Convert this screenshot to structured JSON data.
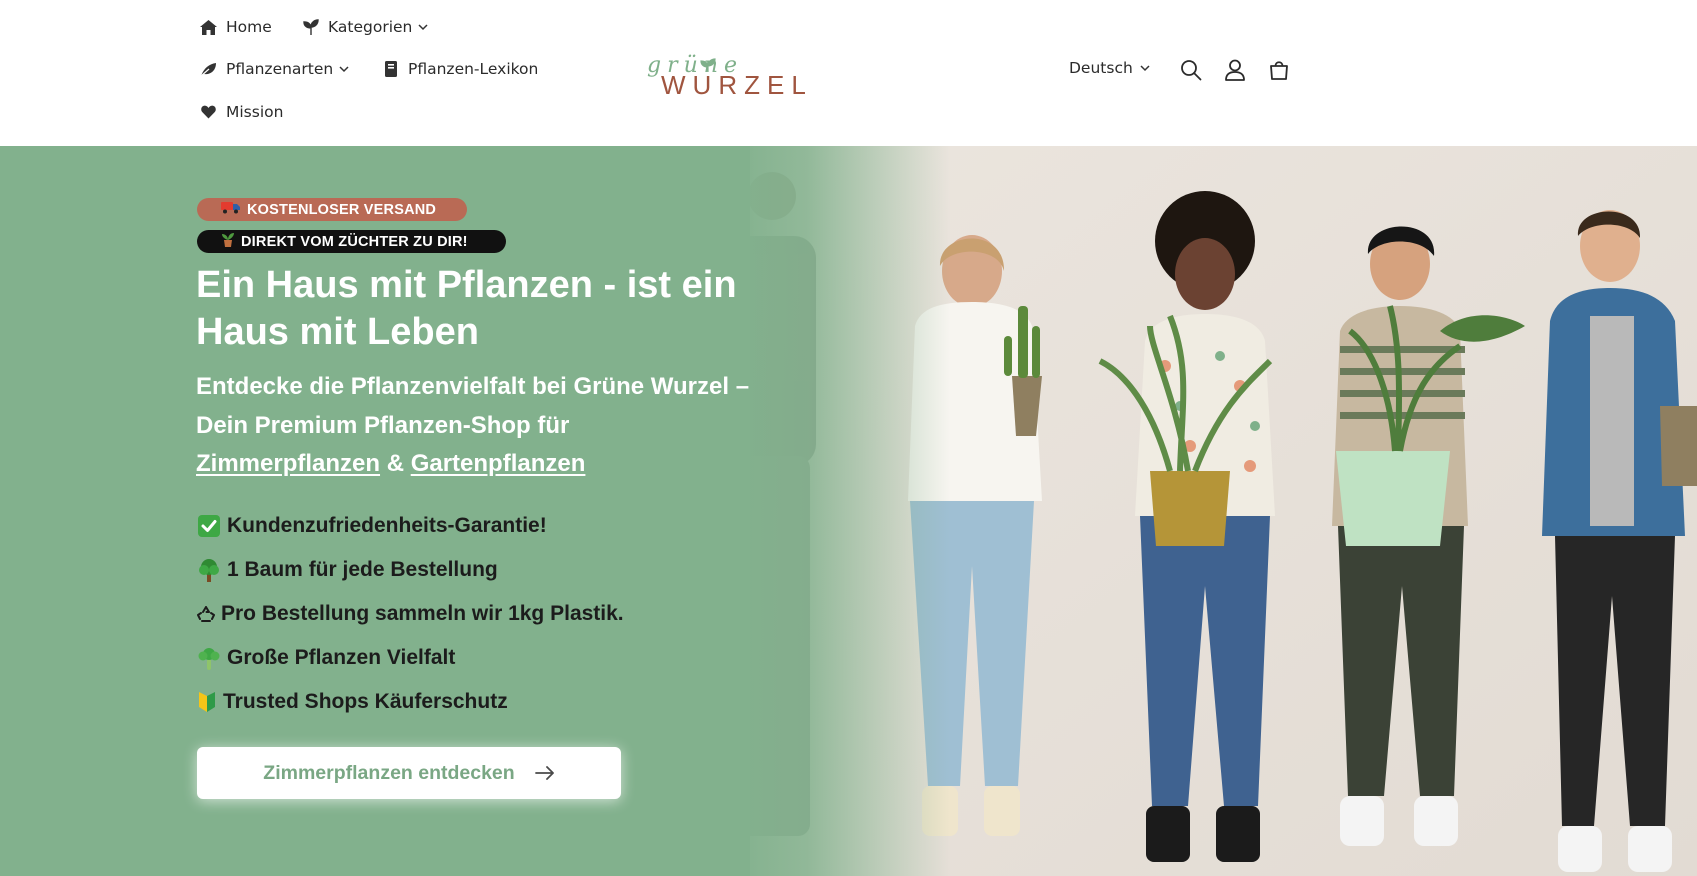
{
  "nav": {
    "home": "Home",
    "kategorien": "Kategorien",
    "pflanzenarten": "Pflanzenarten",
    "lexikon": "Pflanzen-Lexikon",
    "mission": "Mission"
  },
  "logo": {
    "top": "grüne",
    "bottom": "WURZEL"
  },
  "language": {
    "selected": "Deutsch"
  },
  "icons": {
    "search": "search-icon",
    "account": "account-icon",
    "cart": "cart-icon"
  },
  "hero": {
    "badges": {
      "shipping": "KOSTENLOSER VERSAND",
      "direct": "DIREKT VOM ZÜCHTER ZU DIR!"
    },
    "title": "Ein Haus mit Pflanzen - ist ein Haus mit Leben",
    "subtitle_prefix": "Entdecke die Pflanzenvielfalt bei Grüne Wurzel – Dein Premium Pflanzen-Shop für ",
    "subtitle_link1": "Zimmerpflanzen",
    "subtitle_amp": " & ",
    "subtitle_link2": "Gartenpflanzen",
    "features": [
      "Kundenzufriedenheits-Garantie!",
      "1 Baum für jede Bestellung",
      "Pro Bestellung sammeln wir 1kg Plastik.",
      "Große Pflanzen Vielfalt",
      "Trusted Shops Käuferschutz"
    ],
    "cta": "Zimmerpflanzen entdecken"
  },
  "colors": {
    "hero_green": "#82b18d",
    "badge_ship": "#b96a55",
    "badge_dark": "#111111",
    "logo_green": "#7fb08a",
    "logo_brown": "#a0553f"
  }
}
